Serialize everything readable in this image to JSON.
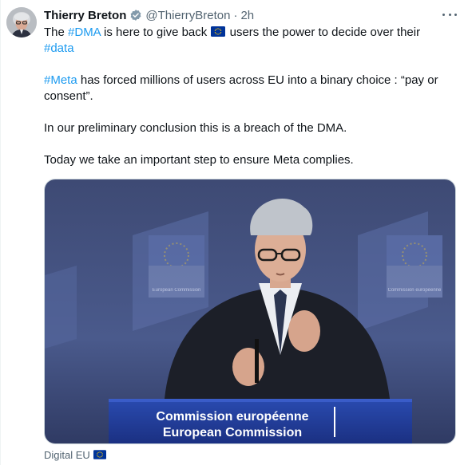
{
  "author": {
    "display_name": "Thierry Breton",
    "handle": "@ThierryBreton",
    "separator": "·",
    "time": "2h"
  },
  "icons": {
    "verified": "verified-badge-icon",
    "more": "more-options-icon",
    "flag": "eu-flag-emoji"
  },
  "tweet": {
    "line1_pre": "The ",
    "tag_dma": "#DMA",
    "line1_mid": " is here to give back ",
    "line1_post": " users the power to decide over their",
    "tag_data": "#data",
    "tag_meta": "#Meta",
    "para2_rest": " has forced millions of users across EU into a binary choice : “pay or consent”.",
    "para3": "In our preliminary conclusion this is a breach of the DMA.",
    "para4": "Today we take an important step to ensure Meta complies."
  },
  "media": {
    "podium_line1": "Commission européenne",
    "podium_line2": "European Commission",
    "banner_text_1": "European Commission",
    "banner_text_2": "Commission européenne"
  },
  "source": {
    "label": "Digital EU"
  },
  "colors": {
    "link": "#1d9bf0",
    "secondary_text": "#536471",
    "eu_blue": "#003399",
    "eu_gold": "#ffcc00",
    "podium_blue": "#1e3a8a"
  }
}
